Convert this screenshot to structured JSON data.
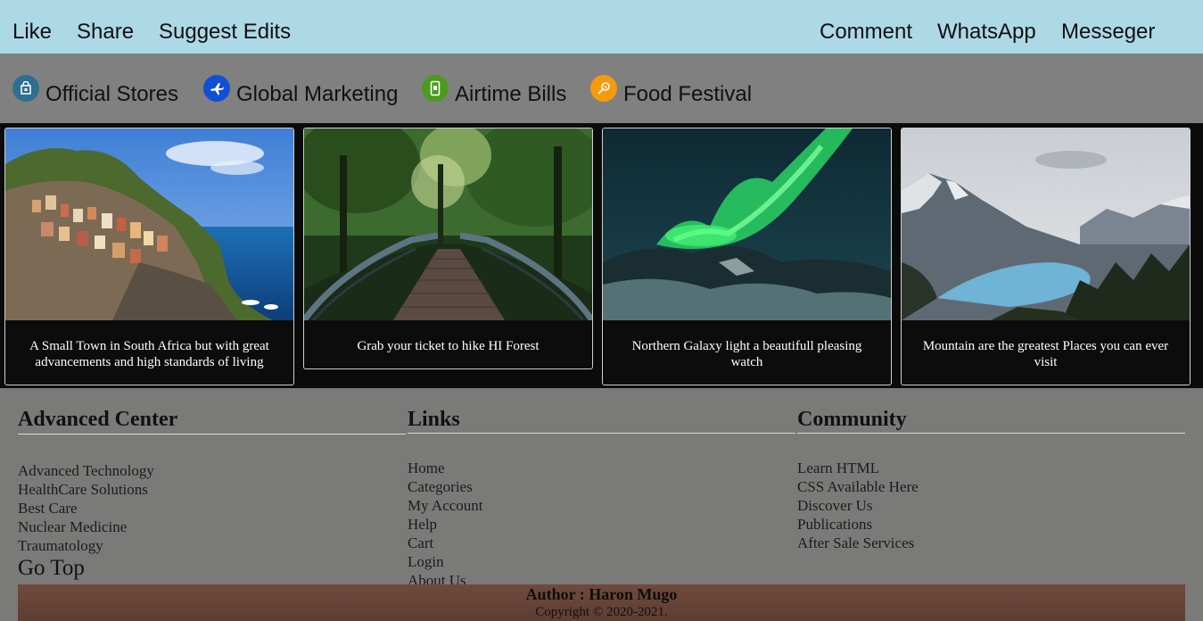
{
  "topnav": {
    "left": [
      "Like",
      "Share",
      "Suggest Edits"
    ],
    "right": [
      "Comment",
      "WhatsApp",
      "Messeger"
    ]
  },
  "categories": [
    {
      "label": "Official Stores",
      "icon": "store-icon",
      "color": "#2f6f8f"
    },
    {
      "label": "Global Marketing",
      "icon": "airplane-icon",
      "color": "#1150d6"
    },
    {
      "label": "Airtime Bills",
      "icon": "phone-icon",
      "color": "#4d9a1f"
    },
    {
      "label": "Food Festival",
      "icon": "food-icon",
      "color": "#f59a0b"
    }
  ],
  "cards": [
    {
      "caption": "A Small Town in South Africa but with great advancements and high standards of living",
      "image": "coastal-town-image"
    },
    {
      "caption": "Grab your ticket to hike HI Forest",
      "image": "forest-bridge-image"
    },
    {
      "caption": "Northern Galaxy light a beautifull pleasing watch",
      "image": "aurora-image"
    },
    {
      "caption": "Mountain are the greatest Places you can ever visit",
      "image": "mountain-lake-image"
    }
  ],
  "footer": {
    "advanced": {
      "title": "Advanced Center",
      "items": [
        "Advanced Technology",
        "HealthCare Solutions",
        "Best Care",
        "Nuclear Medicine",
        "Traumatology"
      ],
      "gotop": "Go Top"
    },
    "links": {
      "title": "Links",
      "items": [
        "Home",
        "Categories",
        "My Account",
        "Help",
        "Cart",
        "Login",
        "About Us"
      ]
    },
    "community": {
      "title": "Community",
      "items": [
        "Learn HTML",
        "CSS Available Here",
        "Discover Us",
        "Publications",
        "After Sale Services"
      ]
    }
  },
  "bottom": {
    "author": "Author : Haron Mugo",
    "copyright": "Copyright © 2020-2021."
  }
}
